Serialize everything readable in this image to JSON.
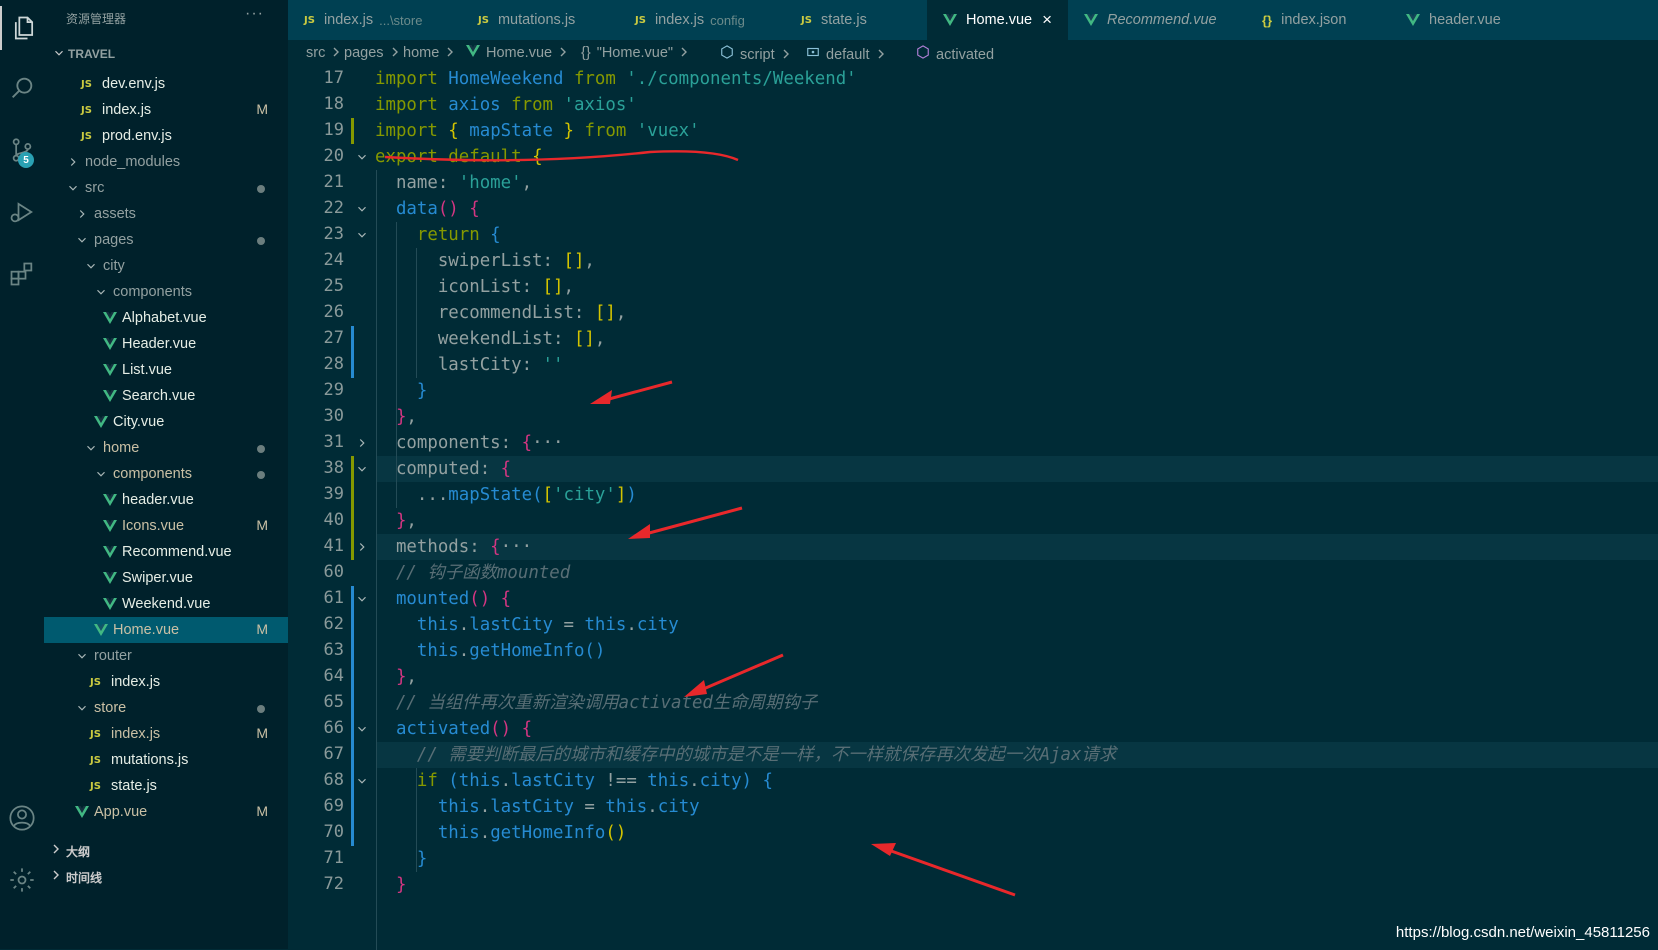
{
  "activity_bar": {
    "icons": [
      "explorer-icon",
      "search-icon",
      "source-control-icon",
      "run-debug-icon",
      "extensions-icon",
      "account-icon",
      "settings-gear-icon"
    ],
    "scm_badge": "5"
  },
  "sidebar": {
    "title": "资源管理器",
    "more": "···",
    "project": "TRAVEL",
    "bottom_sections": [
      "大纲",
      "时间线"
    ]
  },
  "tabs": [
    {
      "label": "index.js",
      "desc": "...\\store",
      "icon": "js-icon"
    },
    {
      "label": "mutations.js",
      "desc": "",
      "icon": "js-icon"
    },
    {
      "label": "index.js",
      "desc": "config",
      "icon": "js-icon"
    },
    {
      "label": "state.js",
      "desc": "",
      "icon": "js-icon"
    },
    {
      "label": "Home.vue",
      "desc": "",
      "icon": "vue-icon",
      "active": true,
      "close": "×"
    },
    {
      "label": "Recommend.vue",
      "desc": "",
      "icon": "vue-icon",
      "preview": true
    },
    {
      "label": "index.json",
      "desc": "",
      "icon": "json-icon"
    },
    {
      "label": "header.vue",
      "desc": "",
      "icon": "vue-icon"
    }
  ],
  "breadcrumb": [
    "src",
    "pages",
    "home",
    "Home.vue",
    "\"Home.vue\"",
    "script",
    "default",
    "activated"
  ],
  "watermark": "https://blog.csdn.net/weixin_45811256",
  "accent_colors": {
    "keyword": "#859900",
    "string": "#2aa198",
    "identifier": "#268bd2",
    "comment": "#586e75",
    "annotation": "#e8282b"
  },
  "tree": [
    {
      "label": "dev.env.js",
      "type": "js",
      "level": 2
    },
    {
      "label": "index.js",
      "type": "js",
      "level": 2,
      "badge": "M"
    },
    {
      "label": "prod.env.js",
      "type": "js",
      "level": 2
    },
    {
      "label": "node_modules",
      "type": "dir",
      "level": 1,
      "open": false
    },
    {
      "label": "src",
      "type": "dir",
      "level": 1,
      "open": true,
      "dot": true
    },
    {
      "label": "assets",
      "type": "dir",
      "level": 2,
      "open": false
    },
    {
      "label": "pages",
      "type": "dir",
      "level": 2,
      "open": true,
      "dot": true
    },
    {
      "label": "city",
      "type": "dir",
      "level": 3,
      "open": true
    },
    {
      "label": "components",
      "type": "dir",
      "level": 4,
      "open": true
    },
    {
      "label": "Alphabet.vue",
      "type": "vue",
      "level": 5
    },
    {
      "label": "Header.vue",
      "type": "vue",
      "level": 5
    },
    {
      "label": "List.vue",
      "type": "vue",
      "level": 5
    },
    {
      "label": "Search.vue",
      "type": "vue",
      "level": 5
    },
    {
      "label": "City.vue",
      "type": "vue",
      "level": 4
    },
    {
      "label": "home",
      "type": "dir",
      "level": 3,
      "open": true,
      "dot": true,
      "modified": true
    },
    {
      "label": "components",
      "type": "dir",
      "level": 4,
      "open": true,
      "dot": true,
      "modified": true
    },
    {
      "label": "header.vue",
      "type": "vue",
      "level": 5
    },
    {
      "label": "Icons.vue",
      "type": "vue",
      "level": 5,
      "badge": "M",
      "modified": true
    },
    {
      "label": "Recommend.vue",
      "type": "vue",
      "level": 5
    },
    {
      "label": "Swiper.vue",
      "type": "vue",
      "level": 5
    },
    {
      "label": "Weekend.vue",
      "type": "vue",
      "level": 5
    },
    {
      "label": "Home.vue",
      "type": "vue",
      "level": 4,
      "badge": "M",
      "selected": true,
      "modified": true
    },
    {
      "label": "router",
      "type": "dir",
      "level": 2,
      "open": true
    },
    {
      "label": "index.js",
      "type": "js",
      "level": 3
    },
    {
      "label": "store",
      "type": "dir",
      "level": 2,
      "open": true,
      "dot": true,
      "modified": true
    },
    {
      "label": "index.js",
      "type": "js",
      "level": 3,
      "badge": "M",
      "modified": true
    },
    {
      "label": "mutations.js",
      "type": "js",
      "level": 3
    },
    {
      "label": "state.js",
      "type": "js",
      "level": 3
    },
    {
      "label": "App.vue",
      "type": "vue",
      "level": 2,
      "badge": "M",
      "modified": true
    }
  ],
  "code": [
    {
      "n": "17",
      "tokens": [
        [
          "kw",
          "import "
        ],
        [
          "id",
          "HomeWeekend"
        ],
        [
          "kw",
          " from "
        ],
        [
          "str",
          "'./components/Weekend'"
        ]
      ]
    },
    {
      "n": "18",
      "tokens": [
        [
          "kw",
          "import "
        ],
        [
          "id",
          "axios"
        ],
        [
          "kw",
          " from "
        ],
        [
          "str",
          "'axios'"
        ]
      ]
    },
    {
      "n": "19",
      "tokens": [
        [
          "kw",
          "import "
        ],
        [
          "p1",
          "{ "
        ],
        [
          "id",
          "mapState"
        ],
        [
          "p1",
          " }"
        ],
        [
          "kw",
          " from "
        ],
        [
          "str",
          "'vuex'"
        ]
      ]
    },
    {
      "n": "20",
      "tokens": [
        [
          "kw",
          "export default "
        ],
        [
          "p1",
          "{"
        ]
      ]
    },
    {
      "n": "21",
      "tokens": [
        [
          "pl",
          "  name: "
        ],
        [
          "str",
          "'home'"
        ],
        [
          "pl",
          ","
        ]
      ]
    },
    {
      "n": "22",
      "tokens": [
        [
          "id",
          "  data"
        ],
        [
          "p2",
          "()"
        ],
        [
          "pl",
          " "
        ],
        [
          "p2",
          "{"
        ]
      ]
    },
    {
      "n": "23",
      "tokens": [
        [
          "kw",
          "    return "
        ],
        [
          "p3",
          "{"
        ]
      ]
    },
    {
      "n": "24",
      "tokens": [
        [
          "pl",
          "      swiperList: "
        ],
        [
          "p1",
          "[]"
        ],
        [
          "pl",
          ","
        ]
      ]
    },
    {
      "n": "25",
      "tokens": [
        [
          "pl",
          "      iconList: "
        ],
        [
          "p1",
          "[]"
        ],
        [
          "pl",
          ","
        ]
      ]
    },
    {
      "n": "26",
      "tokens": [
        [
          "pl",
          "      recommendList: "
        ],
        [
          "p1",
          "[]"
        ],
        [
          "pl",
          ","
        ]
      ]
    },
    {
      "n": "27",
      "tokens": [
        [
          "pl",
          "      weekendList: "
        ],
        [
          "p1",
          "[]"
        ],
        [
          "pl",
          ","
        ]
      ]
    },
    {
      "n": "28",
      "tokens": [
        [
          "pl",
          "      lastCity: "
        ],
        [
          "str",
          "''"
        ]
      ]
    },
    {
      "n": "29",
      "tokens": [
        [
          "p3",
          "    }"
        ]
      ]
    },
    {
      "n": "30",
      "tokens": [
        [
          "p2",
          "  }"
        ],
        [
          "pl",
          ","
        ]
      ]
    },
    {
      "n": "31",
      "tokens": [
        [
          "pl",
          "  components: "
        ],
        [
          "p2",
          "{"
        ],
        [
          "el",
          "···"
        ]
      ]
    },
    {
      "n": "38",
      "tokens": [
        [
          "pl",
          "  computed: "
        ],
        [
          "p2",
          "{"
        ]
      ]
    },
    {
      "n": "39",
      "tokens": [
        [
          "pl",
          "    ..."
        ],
        [
          "id",
          "mapState"
        ],
        [
          "p3",
          "("
        ],
        [
          "p1",
          "["
        ],
        [
          "str",
          "'city'"
        ],
        [
          "p1",
          "]"
        ],
        [
          "p3",
          ")"
        ]
      ]
    },
    {
      "n": "40",
      "tokens": [
        [
          "p2",
          "  }"
        ],
        [
          "pl",
          ","
        ]
      ]
    },
    {
      "n": "41",
      "tokens": [
        [
          "pl",
          "  methods: "
        ],
        [
          "p2",
          "{"
        ],
        [
          "el",
          "···"
        ]
      ]
    },
    {
      "n": "60",
      "tokens": [
        [
          "cm",
          "  // 钩子函数mounted"
        ]
      ]
    },
    {
      "n": "61",
      "tokens": [
        [
          "id",
          "  mounted"
        ],
        [
          "p2",
          "()"
        ],
        [
          "pl",
          " "
        ],
        [
          "p2",
          "{"
        ]
      ]
    },
    {
      "n": "62",
      "tokens": [
        [
          "id",
          "    this"
        ],
        [
          "pl",
          "."
        ],
        [
          "id",
          "lastCity"
        ],
        [
          "pl",
          " = "
        ],
        [
          "id",
          "this"
        ],
        [
          "pl",
          "."
        ],
        [
          "id",
          "city"
        ]
      ]
    },
    {
      "n": "63",
      "tokens": [
        [
          "id",
          "    this"
        ],
        [
          "pl",
          "."
        ],
        [
          "id",
          "getHomeInfo"
        ],
        [
          "p3",
          "()"
        ]
      ]
    },
    {
      "n": "64",
      "tokens": [
        [
          "p2",
          "  }"
        ],
        [
          "pl",
          ","
        ]
      ]
    },
    {
      "n": "65",
      "tokens": [
        [
          "cm",
          "  // 当组件再次重新渲染调用activated生命周期钩子"
        ]
      ]
    },
    {
      "n": "66",
      "tokens": [
        [
          "id",
          "  activated"
        ],
        [
          "p2",
          "()"
        ],
        [
          "pl",
          " "
        ],
        [
          "p2",
          "{"
        ]
      ]
    },
    {
      "n": "67",
      "tokens": [
        [
          "cm",
          "    // 需要判断最后的城市和缓存中的城市是不是一样，不一样就保存再次发起一次Ajax请求"
        ]
      ]
    },
    {
      "n": "68",
      "tokens": [
        [
          "kw",
          "    if "
        ],
        [
          "p3",
          "("
        ],
        [
          "id",
          "this"
        ],
        [
          "pl",
          "."
        ],
        [
          "id",
          "lastCity"
        ],
        [
          "pl",
          " !== "
        ],
        [
          "id",
          "this"
        ],
        [
          "pl",
          "."
        ],
        [
          "id",
          "city"
        ],
        [
          "p3",
          ")"
        ],
        [
          "pl",
          " "
        ],
        [
          "p3",
          "{"
        ]
      ]
    },
    {
      "n": "69",
      "tokens": [
        [
          "id",
          "      this"
        ],
        [
          "pl",
          "."
        ],
        [
          "id",
          "lastCity"
        ],
        [
          "pl",
          " = "
        ],
        [
          "id",
          "this"
        ],
        [
          "pl",
          "."
        ],
        [
          "id",
          "city"
        ]
      ]
    },
    {
      "n": "70",
      "tokens": [
        [
          "id",
          "      this"
        ],
        [
          "pl",
          "."
        ],
        [
          "id",
          "getHomeInfo"
        ],
        [
          "p1",
          "()"
        ]
      ]
    },
    {
      "n": "71",
      "tokens": [
        [
          "p3",
          "    }"
        ]
      ]
    },
    {
      "n": "72",
      "tokens": [
        [
          "p2",
          "  }"
        ]
      ]
    }
  ]
}
